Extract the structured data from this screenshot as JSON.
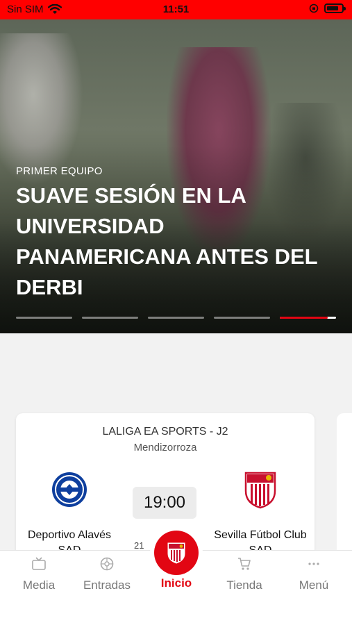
{
  "status_bar": {
    "carrier": "Sin SIM",
    "time": "11:51"
  },
  "hero": {
    "category": "PRIMER EQUIPO",
    "title": "SUAVE SESIÓN EN LA UNIVERSIDAD PANAMERICANA ANTES DEL DERBI",
    "slides": 5,
    "active_slide": 5
  },
  "match": {
    "competition": "LALIGA EA SPORTS - J2",
    "stadium": "Mendizorroza",
    "time": "19:00",
    "date_partial": "21",
    "home_team": "Deportivo Alavés SAD",
    "away_team": "Sevilla Fútbol Club SAD"
  },
  "nav": {
    "media": "Media",
    "entradas": "Entradas",
    "inicio": "Inicio",
    "tienda": "Tienda",
    "menu": "Menú"
  },
  "colors": {
    "accent": "#e20613",
    "status_bar": "#ff0000"
  },
  "icons": {
    "media": "tv-icon",
    "entradas": "ball-icon",
    "tienda": "cart-icon",
    "menu": "more-icon",
    "inicio": "sevilla-crest-icon"
  }
}
